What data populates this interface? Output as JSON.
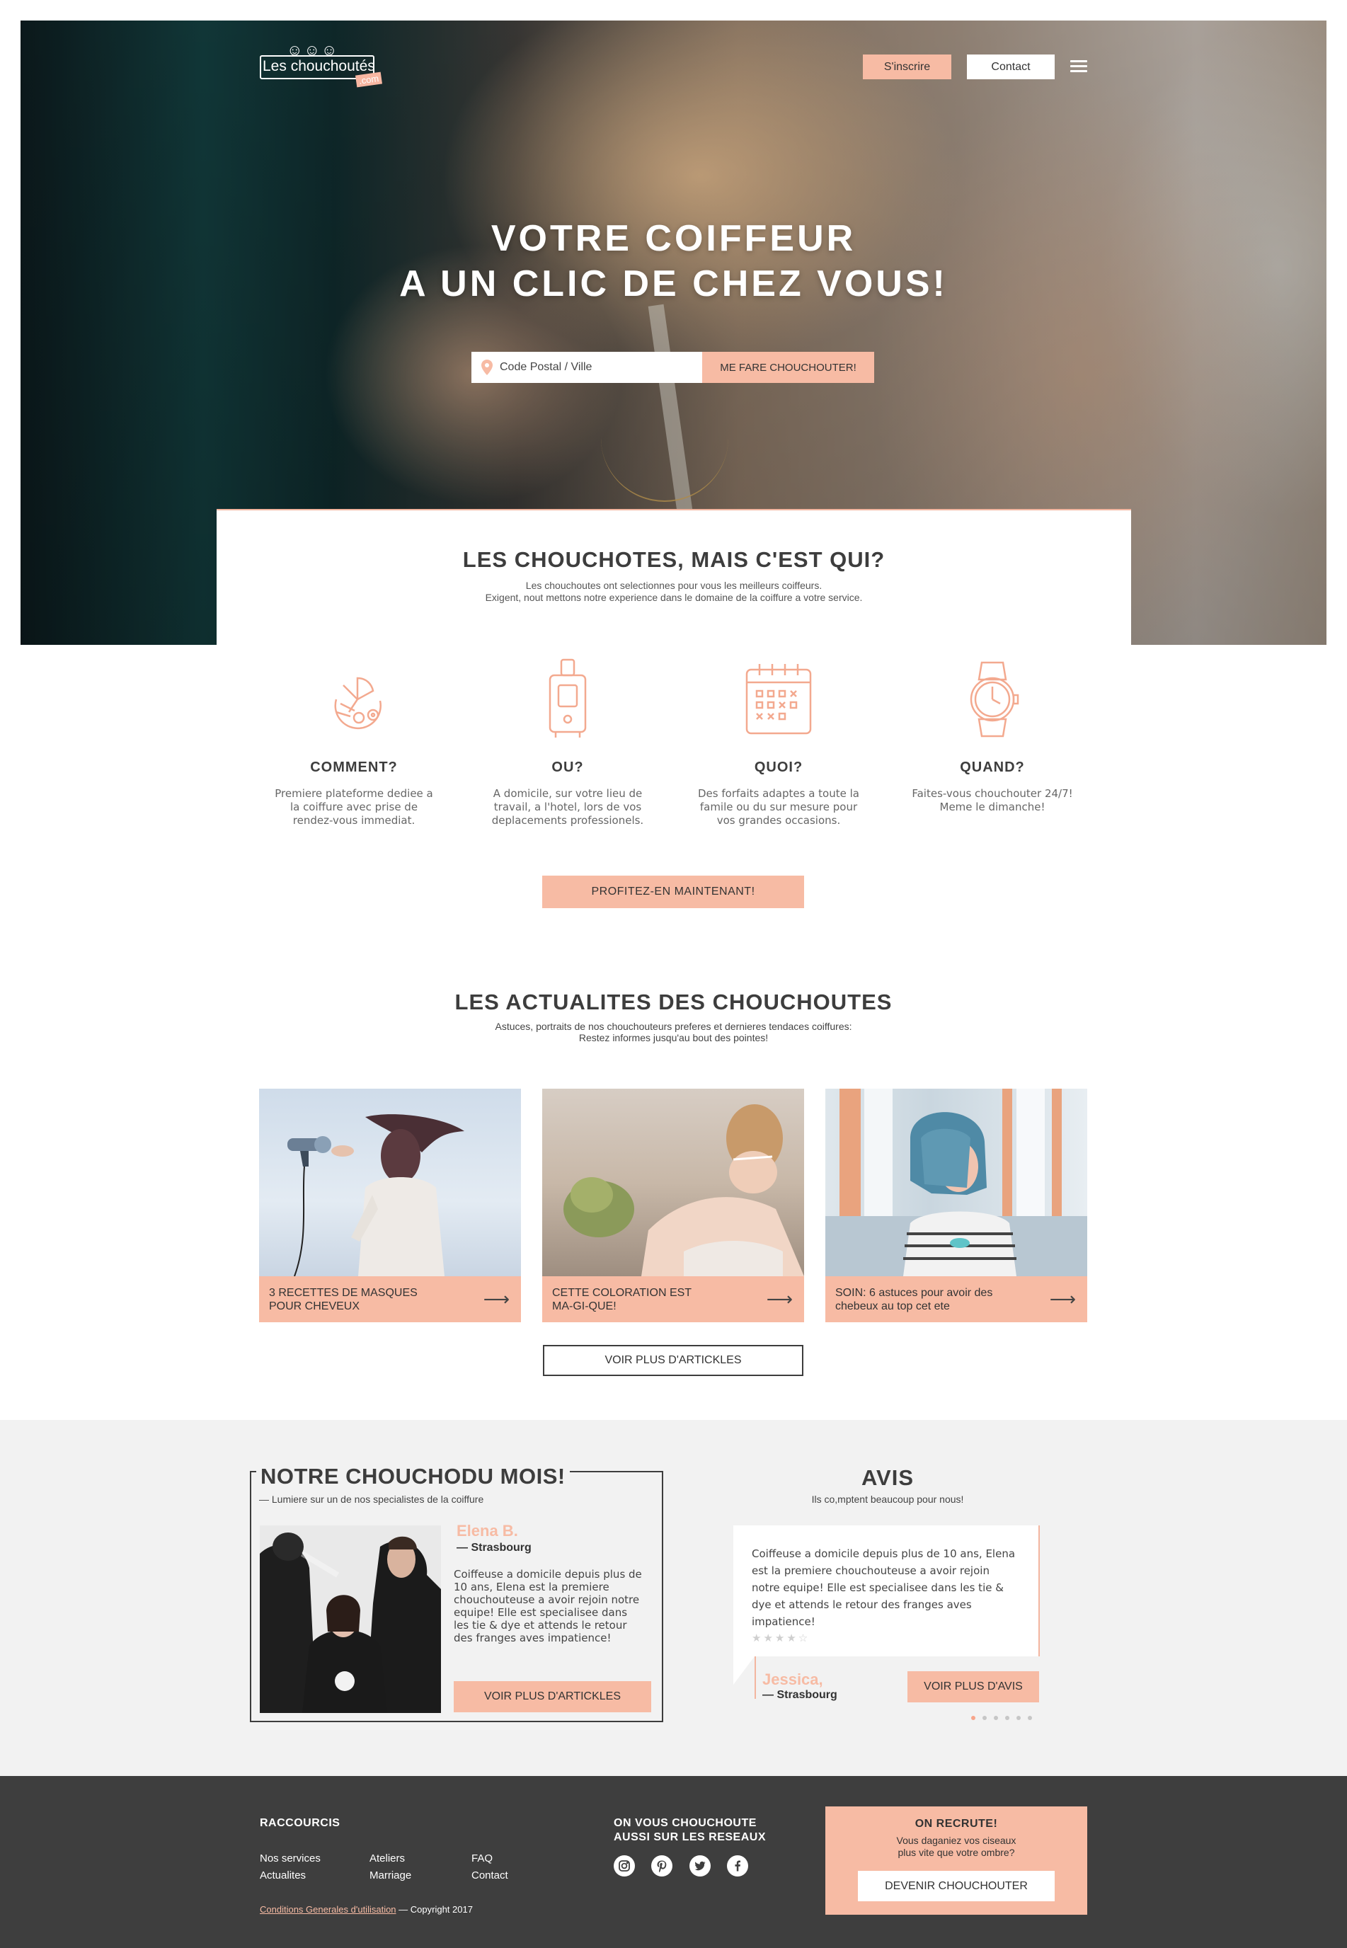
{
  "header": {
    "logo_text": "Les chouchoutés",
    "logo_suffix": ".com",
    "signup_label": "S'inscrire",
    "contact_label": "Contact",
    "menu_icon": "hamburger-menu-icon"
  },
  "hero": {
    "title_line1": "VOTRE COIFFEUR",
    "title_line2": "A UN CLIC DE CHEZ VOUS!",
    "search_placeholder": "Code Postal / Ville",
    "search_icon": "location-pin-icon",
    "search_button": "ME FARE CHOUCHOUTER!"
  },
  "about": {
    "title": "LES CHOUCHOTES, MAIS C'EST QUI?",
    "subtitle_line1": "Les chouchoutes ont selectionnes pour vous les meilleurs coiffeurs.",
    "subtitle_line2": "Exigent, nout mettons notre experience dans le domaine de la coiffure a votre service."
  },
  "features": [
    {
      "icon": "hair-tools-icon",
      "title": "COMMENT?",
      "text": "Premiere plateforme dediee a la coiffure avec prise de rendez-vous immediat."
    },
    {
      "icon": "suitcase-icon",
      "title": "OU?",
      "text": "A domicile, sur votre lieu de travail, a l'hotel, lors de vos deplacements professionels."
    },
    {
      "icon": "calendar-icon",
      "title": "QUOI?",
      "text": "Des forfaits adaptes a toute la famile ou du sur mesure pour vos grandes occasions."
    },
    {
      "icon": "watch-icon",
      "title": "QUAND?",
      "text": "Faites-vous chouchouter 24/7! Meme le dimanche!"
    }
  ],
  "cta_profit": "PROFITEZ-EN MAINTENANT!",
  "news": {
    "title": "LES ACTUALITES DES CHOUCHOUTES",
    "subtitle_line1": "Astuces, portraits de nos chouchouteurs preferes et dernieres tendaces coiffures:",
    "subtitle_line2": "Restez informes jusqu'au bout des pointes!",
    "articles": [
      {
        "caption": "3 RECETTES DE MASQUES POUR CHEVEUX",
        "arrow_icon": "arrow-right-icon"
      },
      {
        "caption": "CETTE COLORATION EST MA-GI-QUE!",
        "arrow_icon": "arrow-right-icon"
      },
      {
        "caption": "SOIN: 6 astuces pour avoir des chebeux au top cet ete",
        "arrow_icon": "arrow-right-icon"
      }
    ],
    "more_button": "VOIR PLUS D'ARTICKLES"
  },
  "month": {
    "title": "NOTRE CHOUCHODU MOIS!",
    "subtitle": "— Lumiere sur un de nos specialistes de la coiffure",
    "name": "Elena B.",
    "city": "— Strasbourg",
    "text": "Coiffeuse a domicile depuis plus de 10 ans, Elena est la premiere chouchouteuse a avoir rejoin notre equipe! Elle est specialisee dans les tie & dye et attends le retour des franges aves impatience!",
    "button": "VOIR PLUS D'ARTICKLES"
  },
  "reviews": {
    "title": "AVIS",
    "subtitle": "Ils co,mptent beaucoup pour nous!",
    "text": "Coiffeuse a domicile depuis plus de 10 ans, Elena est la premiere chouchouteuse a avoir rejoin notre equipe! Elle est specialisee dans les tie & dye et attends le retour des franges aves impatience!",
    "stars": "★★★★☆",
    "rating": 4,
    "name": "Jessica,",
    "city": "— Strasbourg",
    "button": "VOIR PLUS D'AVIS",
    "active_dot": 0,
    "dot_count": 6
  },
  "footer": {
    "shortcuts_title": "RACCOURCIS",
    "links": {
      "services": "Nos services",
      "news": "Actualites",
      "workshops": "Ateliers",
      "wedding": "Marriage",
      "faq": "FAQ",
      "contact": "Contact"
    },
    "legal_link": "Conditions Generales d'utilisation",
    "copyright": " — Copyright 2017",
    "social_title_line1": "ON VOUS CHOUCHOUTE",
    "social_title_line2": "AUSSI SUR LES RESEAUX",
    "social_icons": [
      "instagram-icon",
      "pinterest-icon",
      "twitter-icon",
      "facebook-icon"
    ],
    "recruit_title": "ON RECRUTE!",
    "recruit_line1": "Vous daganiez vos ciseaux",
    "recruit_line2": "plus vite que votre ombre?",
    "recruit_button": "DEVENIR CHOUCHOUTER"
  },
  "colors": {
    "accent": "#f7bba4",
    "accent_line": "#f3b59f",
    "text_dark": "#3d3d3d",
    "footer_bg": "#3e3e3e",
    "band_bg": "#f2f2f2"
  }
}
